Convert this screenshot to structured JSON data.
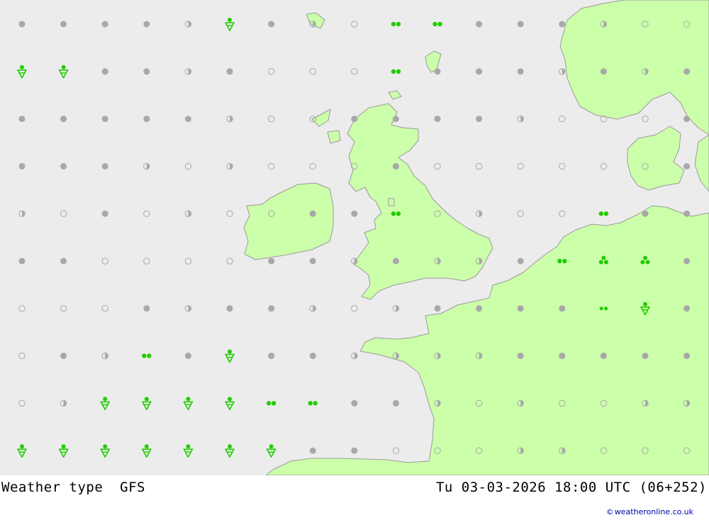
{
  "title": {
    "name": "Weather type",
    "model": "GFS"
  },
  "valid_time": "Tu 03-03-2026 18:00 UTC (06+252)",
  "credit": "weatheronline.co.uk",
  "credit_symbol": "©",
  "colors": {
    "sea": "#ececec",
    "land": "#ccffaa",
    "coast": "#9a9a9a",
    "symbol_gray": "#a8a8a8",
    "symbol_green": "#22cc00"
  },
  "legend_codes": {
    "F": "filled gray dot",
    "H": "half-filled gray dot",
    "O": "open circle",
    "R": "green rain pair",
    "T": "green drizzle triple",
    "S": "green shower",
    "D": "green drops pair"
  },
  "symbol_grid": [
    "FFFFHSFHORRFFFHOO",
    "SSFFHFOOORFFFHFHF",
    "FFFFFHOOFFFFHOOOF",
    "FFFHOHOOOFOOOOOOF",
    "HOFOHOOFFROHOORFF",
    "FFOOOOFFHFHHFRTTF",
    "OOOFHFFHOHFFFFDSF",
    "OFHRFSFFHHHHFFFFF",
    "OHSSSSRRFFHOHOOHH",
    "SSSSSSSFFOOOHHOOO"
  ]
}
